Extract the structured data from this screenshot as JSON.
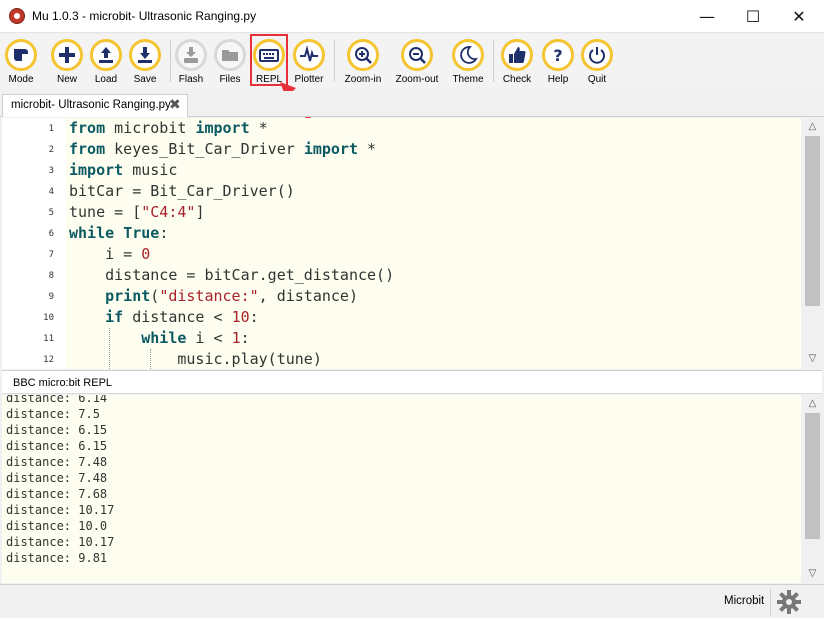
{
  "window": {
    "title": "Mu 1.0.3 - microbit- Ultrasonic Ranging.py"
  },
  "toolbar": {
    "buttons": [
      {
        "label": "Mode",
        "icon": "mode-icon"
      },
      {
        "label": "New",
        "icon": "plus-icon"
      },
      {
        "label": "Load",
        "icon": "upload-icon"
      },
      {
        "label": "Save",
        "icon": "download-icon"
      },
      {
        "label": "Flash",
        "icon": "flash-icon"
      },
      {
        "label": "Files",
        "icon": "folder-icon"
      },
      {
        "label": "REPL",
        "icon": "keyboard-icon"
      },
      {
        "label": "Plotter",
        "icon": "pulse-icon"
      },
      {
        "label": "Zoom-in",
        "icon": "zoom-in-icon"
      },
      {
        "label": "Zoom-out",
        "icon": "zoom-out-icon"
      },
      {
        "label": "Theme",
        "icon": "moon-icon"
      },
      {
        "label": "Check",
        "icon": "thumbs-up-icon"
      },
      {
        "label": "Help",
        "icon": "question-icon"
      },
      {
        "label": "Quit",
        "icon": "power-icon"
      }
    ]
  },
  "tabs": [
    {
      "label": "microbit- Ultrasonic Ranging.py",
      "close": "✖"
    }
  ],
  "editor": {
    "lines": [
      {
        "n": "1",
        "code": "from microbit import *"
      },
      {
        "n": "2",
        "code": "from keyes_Bit_Car_Driver import *"
      },
      {
        "n": "3",
        "code": "import music"
      },
      {
        "n": "4",
        "code": "bitCar = Bit_Car_Driver()"
      },
      {
        "n": "5",
        "code": "tune = [\"C4:4\"]"
      },
      {
        "n": "6",
        "code": "while True:"
      },
      {
        "n": "7",
        "code": "    i = 0"
      },
      {
        "n": "8",
        "code": "    distance = bitCar.get_distance()"
      },
      {
        "n": "9",
        "code": "    print(\"distance:\", distance)"
      },
      {
        "n": "10",
        "code": "    if distance < 10:"
      },
      {
        "n": "11",
        "code": "        while i < 1:"
      },
      {
        "n": "12",
        "code": "            music.play(tune)"
      }
    ]
  },
  "repl": {
    "title": "BBC micro:bit REPL",
    "lines": [
      "distance: 6.14",
      "distance: 7.5",
      "distance: 6.15",
      "distance: 6.15",
      "distance: 7.48",
      "distance: 7.48",
      "distance: 7.68",
      "distance: 10.17",
      "distance: 10.0",
      "distance: 10.17",
      "distance: 9.81"
    ]
  },
  "status": {
    "mode": "Microbit"
  },
  "colors": {
    "accent": "#f5c431",
    "highlight": "#e8303a",
    "editor_bg": "#fefef0",
    "keyword": "#0b5a62",
    "string": "#a8202a"
  }
}
